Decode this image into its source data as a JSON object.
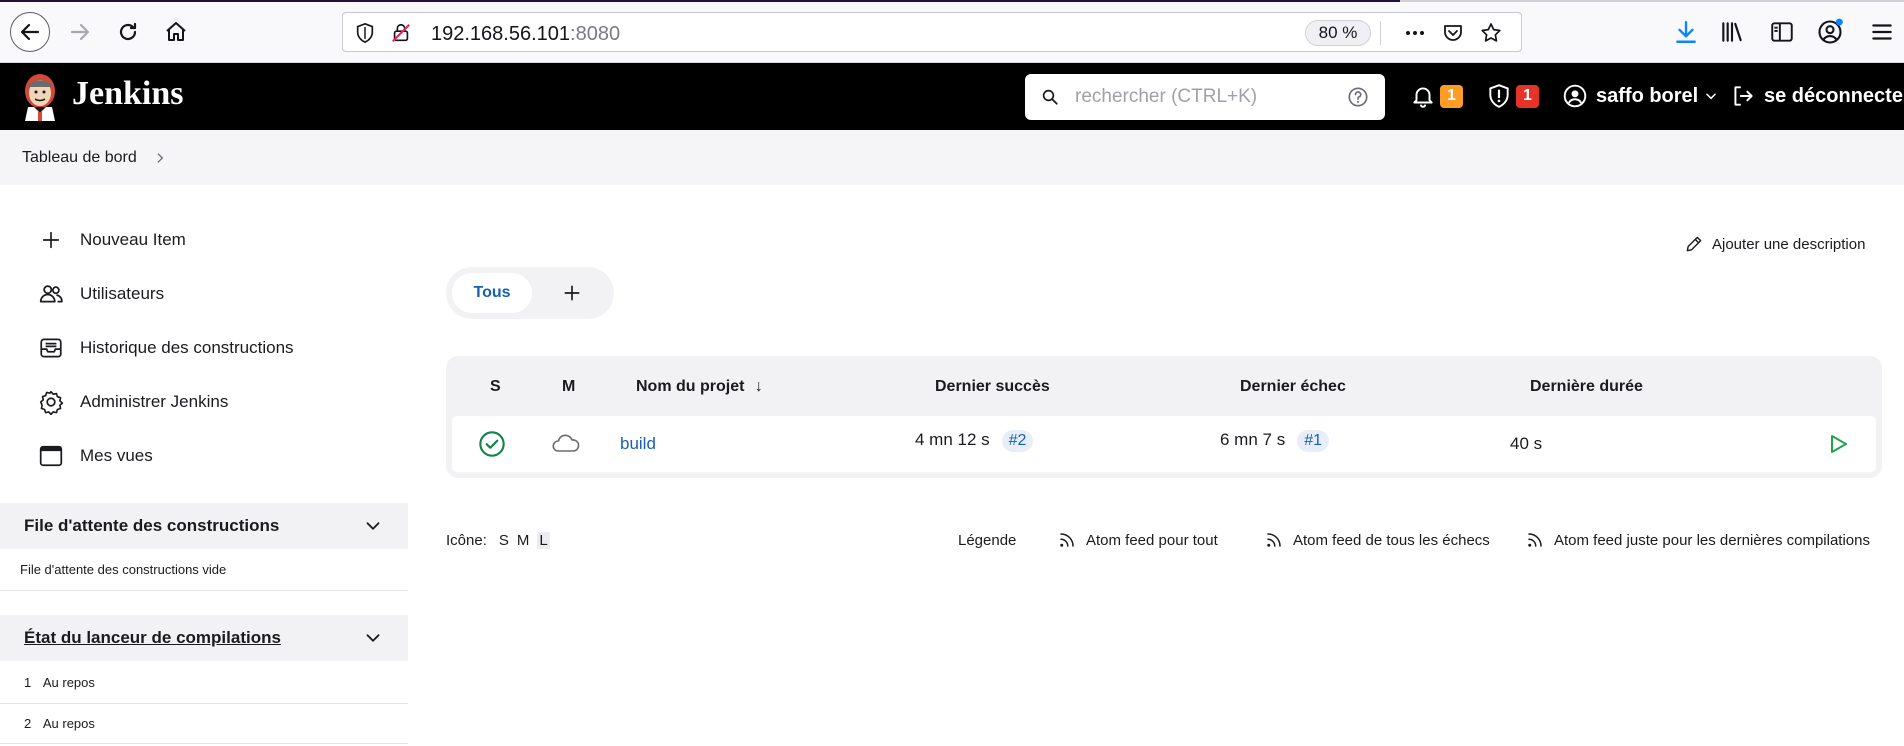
{
  "browser": {
    "url_host": "192.168.56.101",
    "url_port": ":8080",
    "zoom": "80 %"
  },
  "header": {
    "brand": "Jenkins",
    "search_placeholder": "rechercher (CTRL+K)",
    "notifications_count": "1",
    "security_count": "1",
    "user_name": "saffo borel",
    "logout_label": "se déconnecter"
  },
  "breadcrumb": {
    "root": "Tableau de bord"
  },
  "sidebar": {
    "items": [
      {
        "label": "Nouveau Item",
        "icon": "plus-icon"
      },
      {
        "label": "Utilisateurs",
        "icon": "users-icon"
      },
      {
        "label": "Historique des constructions",
        "icon": "inbox-icon"
      },
      {
        "label": "Administrer Jenkins",
        "icon": "gear-icon"
      },
      {
        "label": "Mes vues",
        "icon": "window-icon"
      }
    ],
    "queue_title": "File d'attente des constructions",
    "queue_empty": "File d'attente des constructions vide",
    "executors_title": "État du lanceur de compilations",
    "executors": [
      {
        "num": "1",
        "status": "Au repos"
      },
      {
        "num": "2",
        "status": "Au repos"
      }
    ]
  },
  "main": {
    "add_description": "Ajouter une description",
    "tab_all": "Tous",
    "table": {
      "headers": {
        "s": "S",
        "m": "M",
        "name": "Nom du projet",
        "sort_arrow": "↓",
        "last_success": "Dernier succès",
        "last_failure": "Dernier échec",
        "last_duration": "Dernière durée"
      },
      "rows": [
        {
          "name": "build",
          "last_success": "4 mn 12 s",
          "last_success_build": "#2",
          "last_failure": "6 mn 7 s",
          "last_failure_build": "#1",
          "last_duration": "40 s"
        }
      ]
    },
    "footer": {
      "icon_label": "Icône:",
      "size_s": "S",
      "size_m": "M",
      "size_l": "L",
      "legend": "Légende",
      "feed_all": "Atom feed pour tout",
      "feed_failures": "Atom feed de tous les échecs",
      "feed_latest": "Atom feed juste pour les dernières compilations"
    }
  },
  "colors": {
    "header_bg": "#000000",
    "link": "#1a5fb4",
    "success": "#138347",
    "build_now": "#1ea64b",
    "badge_orange": "#fe9c27",
    "badge_red": "#e6332a",
    "download": "#0a84ff"
  }
}
